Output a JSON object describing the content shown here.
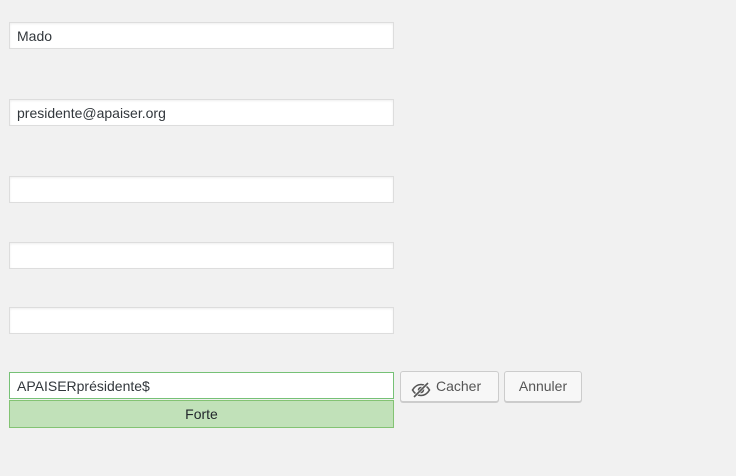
{
  "form": {
    "name_value": "Mado",
    "email_value": "presidente@apaiser.org",
    "empty1_value": "",
    "empty2_value": "",
    "empty3_value": "",
    "password_value": "APAISERprésidente$",
    "strength_label": "Forte",
    "hide_button_label": "Cacher",
    "cancel_button_label": "Annuler"
  },
  "icons": {
    "hide": "eye-slash-icon"
  },
  "colors": {
    "strength_background": "#c1e1b9",
    "strength_border": "#83c373",
    "password_border": "#76c176"
  }
}
